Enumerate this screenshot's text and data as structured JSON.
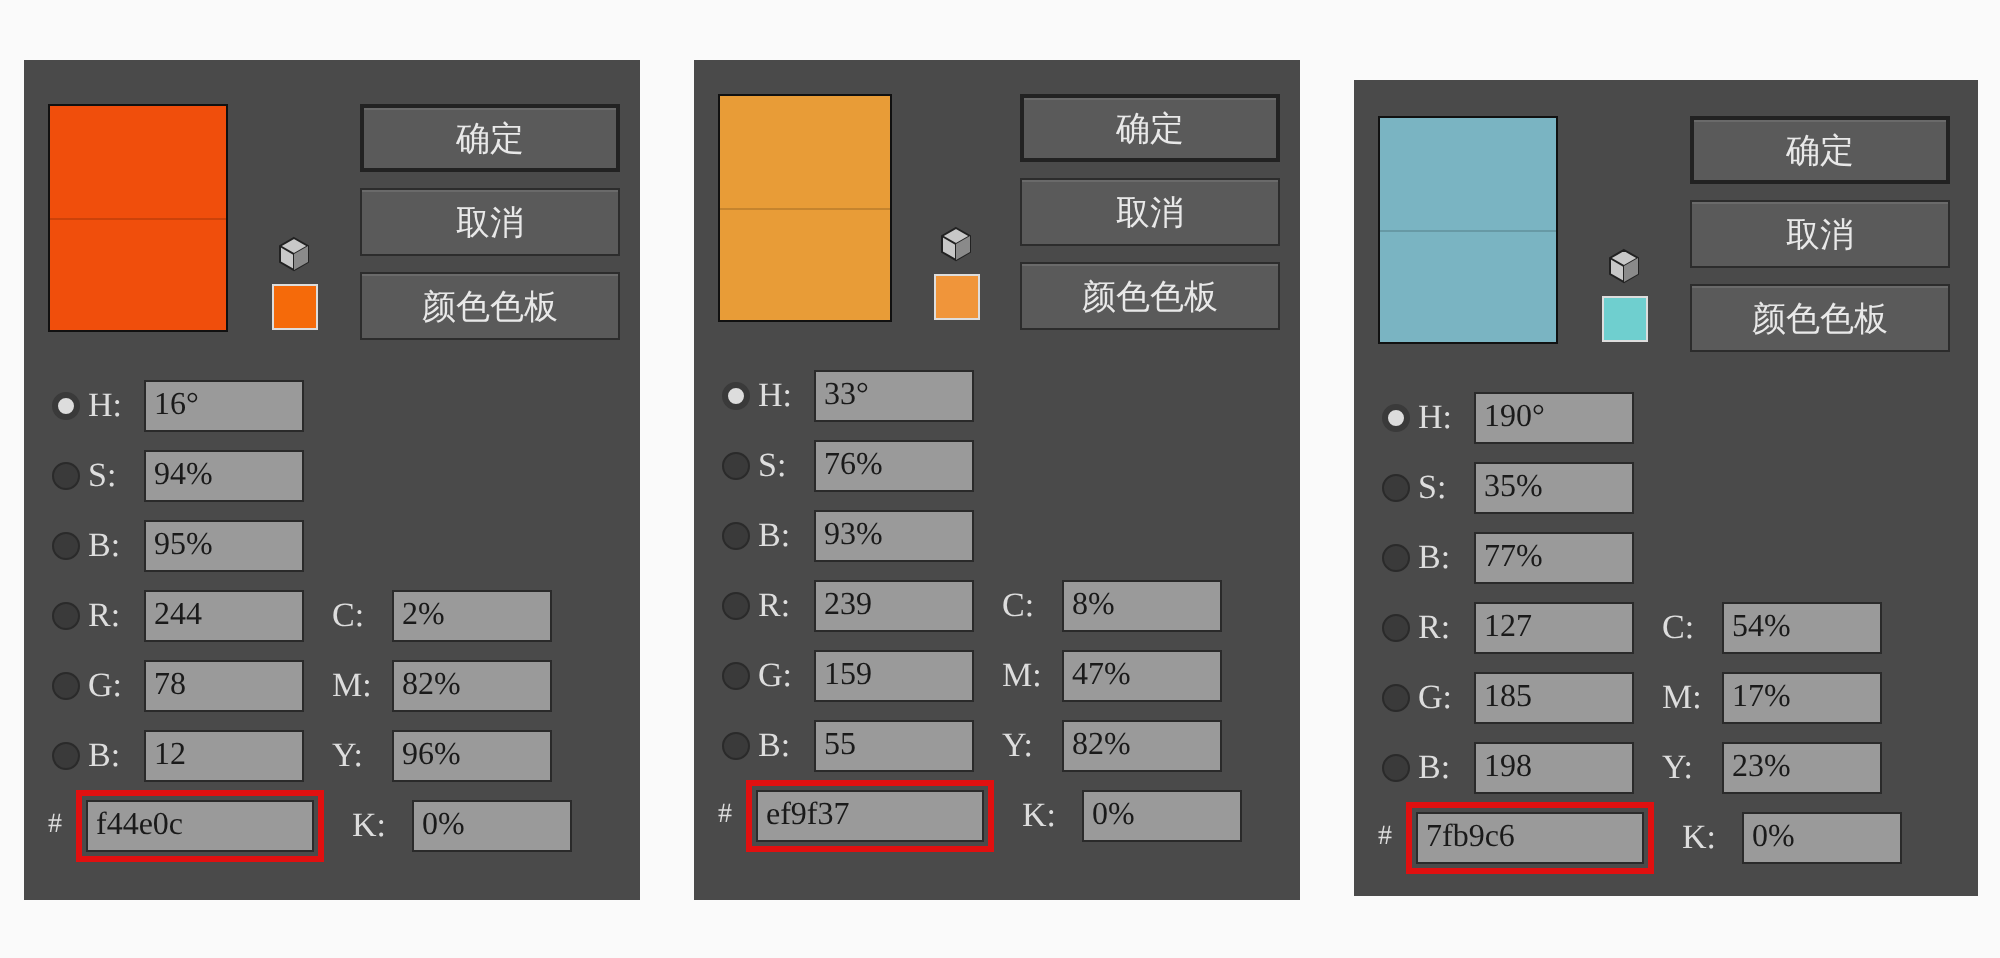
{
  "panels": [
    {
      "preview": {
        "color": "#f04e0c"
      },
      "swatch": {
        "color": "#f56a0a"
      },
      "buttons": [
        "确定",
        "取消",
        "颜色色板"
      ],
      "fields": [
        {
          "label": "H:",
          "value": "16°",
          "selected": true
        },
        {
          "label": "S:",
          "value": "94%",
          "selected": false
        },
        {
          "label": "B:",
          "value": "95%",
          "selected": false
        },
        {
          "label": "R:",
          "value": "244",
          "selected": false
        },
        {
          "label": "G:",
          "value": "78",
          "selected": false
        },
        {
          "label": "B:",
          "value": "12",
          "selected": false
        }
      ],
      "cmyk": [
        {
          "label": "C:",
          "value": "2%"
        },
        {
          "label": "M:",
          "value": "82%"
        },
        {
          "label": "Y:",
          "value": "96%"
        },
        {
          "label": "K:",
          "value": "0%"
        }
      ],
      "hex": {
        "label": "#",
        "value": "f44e0c",
        "highlighted": true
      }
    },
    {
      "preview": {
        "color": "#e89c37"
      },
      "swatch": {
        "color": "#f0953a"
      },
      "buttons": [
        "确定",
        "取消",
        "颜色色板"
      ],
      "fields": [
        {
          "label": "H:",
          "value": "33°",
          "selected": true
        },
        {
          "label": "S:",
          "value": "76%",
          "selected": false
        },
        {
          "label": "B:",
          "value": "93%",
          "selected": false
        },
        {
          "label": "R:",
          "value": "239",
          "selected": false
        },
        {
          "label": "G:",
          "value": "159",
          "selected": false
        },
        {
          "label": "B:",
          "value": "55",
          "selected": false
        }
      ],
      "cmyk": [
        {
          "label": "C:",
          "value": "8%"
        },
        {
          "label": "M:",
          "value": "47%"
        },
        {
          "label": "Y:",
          "value": "82%"
        },
        {
          "label": "K:",
          "value": "0%"
        }
      ],
      "hex": {
        "label": "#",
        "value": "ef9f37",
        "highlighted": true
      }
    },
    {
      "preview": {
        "color": "#7ab4c2"
      },
      "swatch": {
        "color": "#6fcfcf"
      },
      "buttons": [
        "确定",
        "取消",
        "颜色色板"
      ],
      "fields": [
        {
          "label": "H:",
          "value": "190°",
          "selected": true
        },
        {
          "label": "S:",
          "value": "35%",
          "selected": false
        },
        {
          "label": "B:",
          "value": "77%",
          "selected": false
        },
        {
          "label": "R:",
          "value": "127",
          "selected": false
        },
        {
          "label": "G:",
          "value": "185",
          "selected": false
        },
        {
          "label": "B:",
          "value": "198",
          "selected": false
        }
      ],
      "cmyk": [
        {
          "label": "C:",
          "value": "54%"
        },
        {
          "label": "M:",
          "value": "17%"
        },
        {
          "label": "Y:",
          "value": "23%"
        },
        {
          "label": "K:",
          "value": "0%"
        }
      ],
      "hex": {
        "label": "#",
        "value": "7fb9c6",
        "highlighted": true
      }
    }
  ]
}
